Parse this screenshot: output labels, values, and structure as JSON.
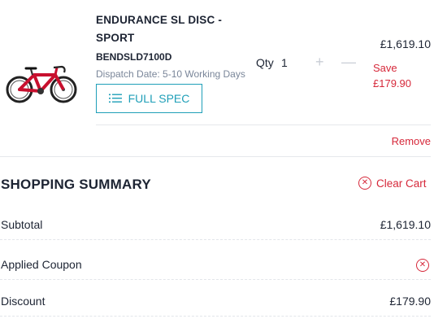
{
  "cart_item": {
    "name_line1": "ENDURANCE SL DISC -",
    "name_line2": "SPORT",
    "sku": "BENDSLD7100D",
    "dispatch": "Dispatch Date: 5-10 Working Days",
    "full_spec_label": "FULL SPEC",
    "qty_label": "Qty",
    "qty_value": "1",
    "qty_plus": "+",
    "qty_minus": "—",
    "price": "£1,619.10",
    "save_label": "Save",
    "save_amount": "£179.90",
    "remove_label": "Remove"
  },
  "summary": {
    "title": "SHOPPING SUMMARY",
    "clear_cart_label": "Clear Cart",
    "rows": [
      {
        "label": "Subtotal",
        "value": "£1,619.10"
      },
      {
        "label": "Applied Coupon",
        "value": ""
      },
      {
        "label": "Discount",
        "value": "£179.90"
      }
    ]
  },
  "colors": {
    "accent": "#1f9fb8",
    "danger": "#d6283a",
    "text": "#1d2433",
    "muted": "#7a8699"
  },
  "icons": {
    "spec": "list-icon",
    "clear_cart": "x-circle-icon",
    "coupon_remove": "x-circle-icon",
    "product": "road-bike-image"
  }
}
